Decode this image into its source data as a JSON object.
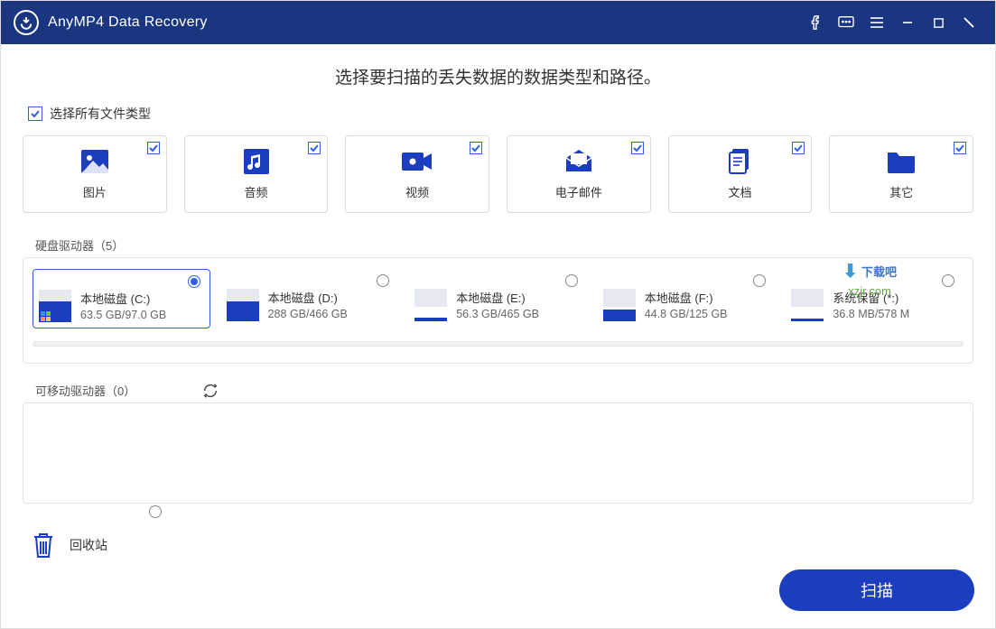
{
  "titlebar": {
    "title": "AnyMP4 Data Recovery"
  },
  "heading": "选择要扫描的丢失数据的数据类型和路径。",
  "selectAllLabel": "选择所有文件类型",
  "fileTypes": [
    {
      "label": "图片"
    },
    {
      "label": "音频"
    },
    {
      "label": "视频"
    },
    {
      "label": "电子邮件"
    },
    {
      "label": "文档"
    },
    {
      "label": "其它"
    }
  ],
  "hddSectionLabel": "硬盘驱动器（5）",
  "drives": [
    {
      "name": "本地磁盘 (C:)",
      "size": "63.5 GB/97.0 GB",
      "fill": 65,
      "winlogo": true
    },
    {
      "name": "本地磁盘 (D:)",
      "size": "288 GB/466 GB",
      "fill": 62,
      "winlogo": false
    },
    {
      "name": "本地磁盘 (E:)",
      "size": "56.3 GB/465 GB",
      "fill": 12,
      "winlogo": false
    },
    {
      "name": "本地磁盘 (F:)",
      "size": "44.8 GB/125 GB",
      "fill": 36,
      "winlogo": false
    },
    {
      "name": "系统保留 (*:)",
      "size": "36.8 MB/578 M",
      "fill": 7,
      "winlogo": false
    }
  ],
  "removableSectionLabel": "可移动驱动器（0）",
  "recycleLabel": "回收站",
  "scanButton": "扫描",
  "watermark": {
    "top": "下载吧",
    "url": "xzjr.com"
  }
}
